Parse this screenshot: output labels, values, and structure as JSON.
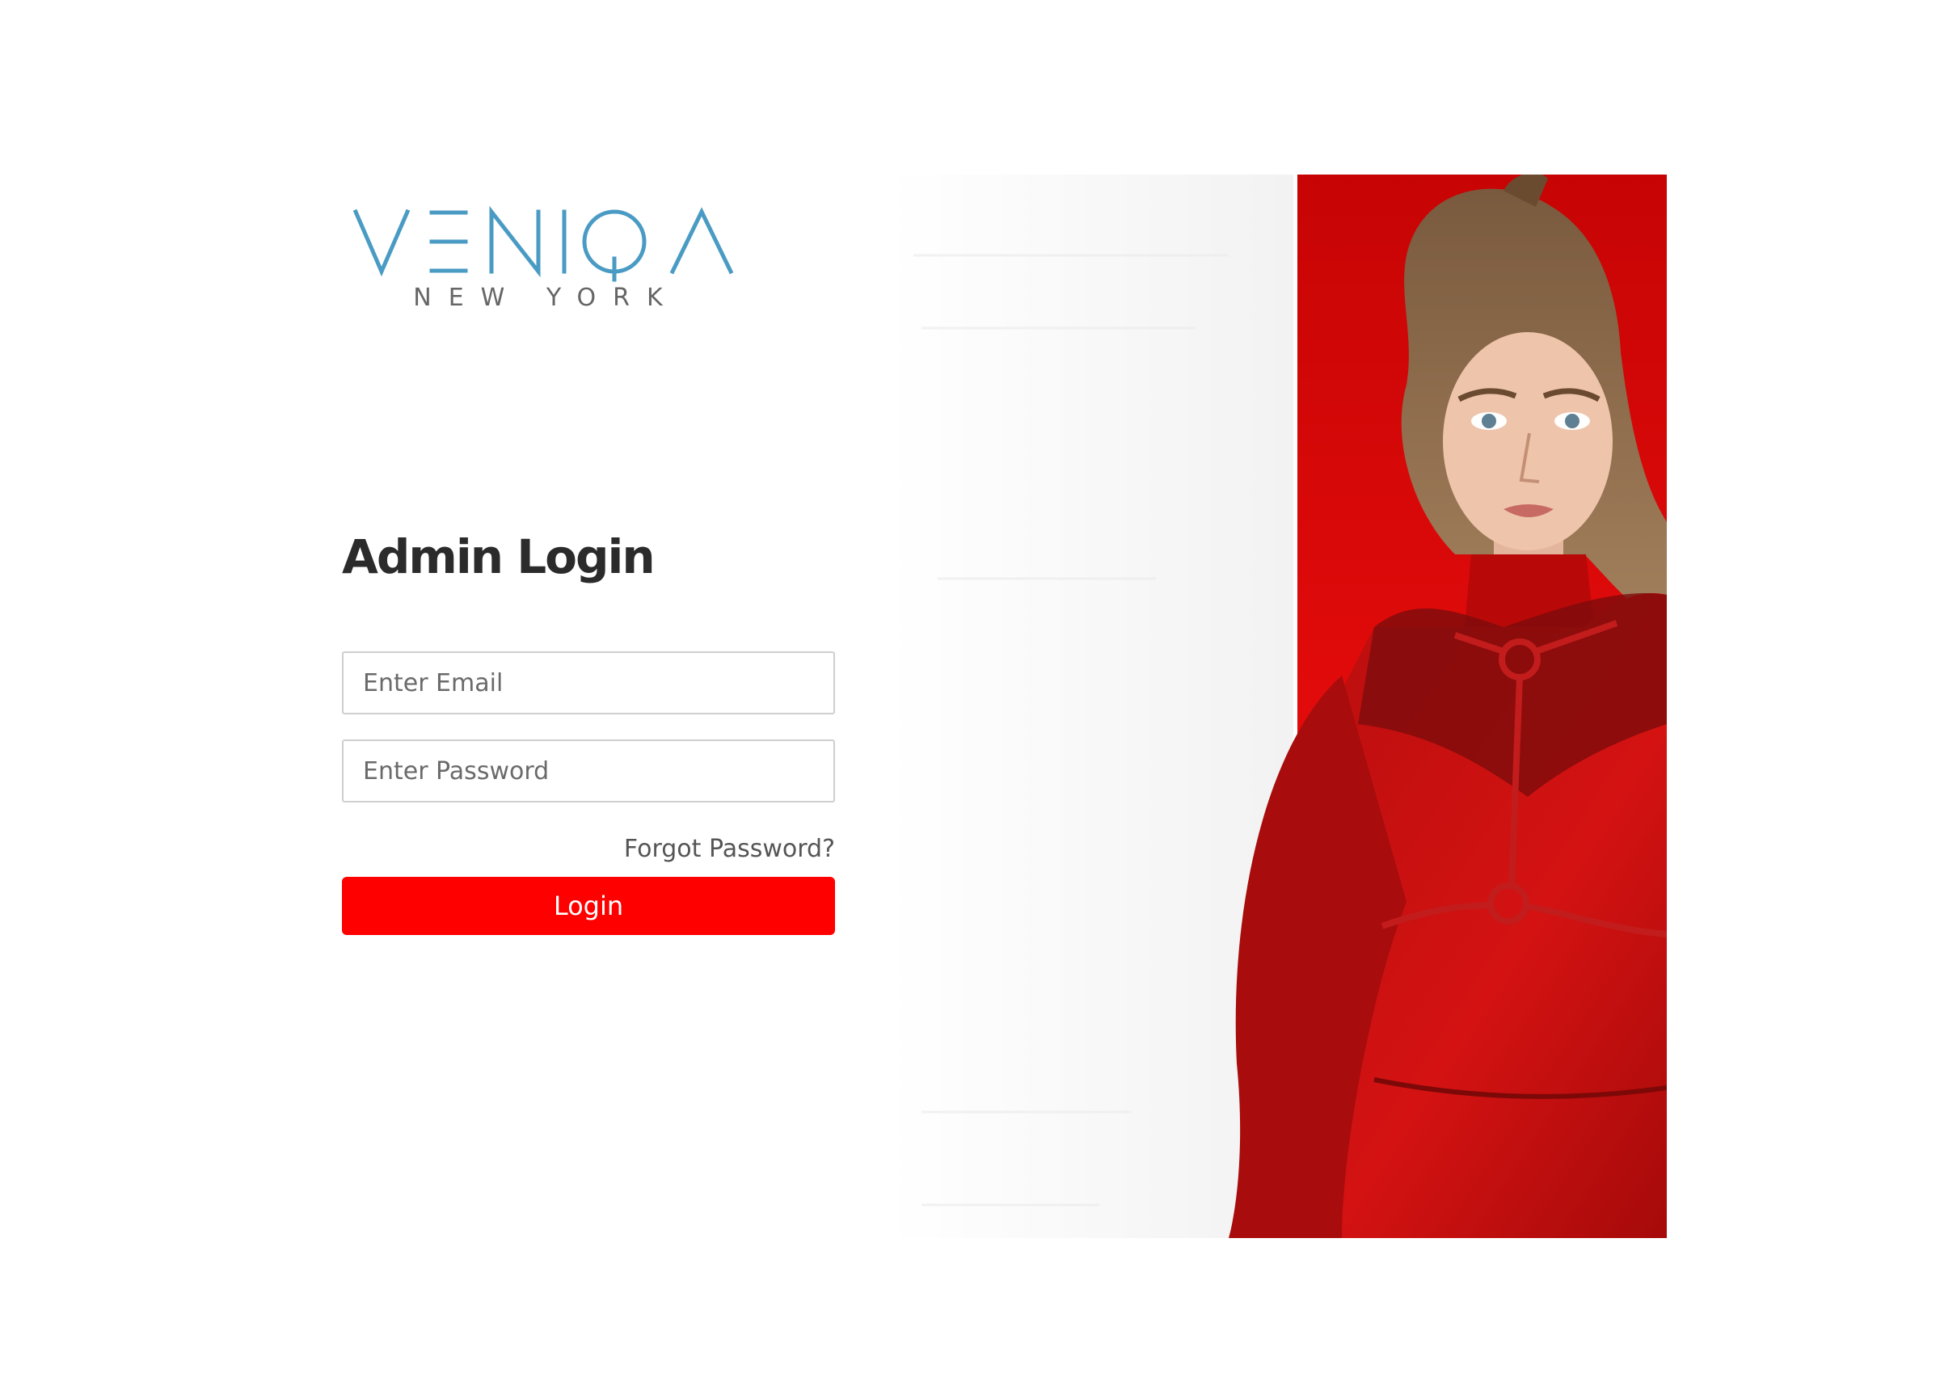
{
  "brand": {
    "logo_primary": "VENIQA",
    "logo_secondary": "NEW YORK",
    "logo_color": "#4a9bc4",
    "logo_secondary_color": "#666666"
  },
  "login": {
    "title": "Admin Login",
    "email_placeholder": "Enter Email",
    "password_placeholder": "Enter Password",
    "forgot_label": "Forgot Password?",
    "submit_label": "Login",
    "accent_color": "#ff0000"
  },
  "hero": {
    "icon": "fashion-model-photo",
    "primary_color": "#e00000"
  }
}
